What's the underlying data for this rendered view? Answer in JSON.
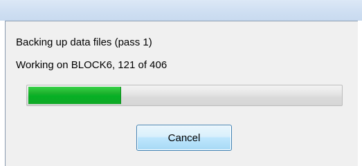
{
  "dialog": {
    "status_line_1": "Backing up data files (pass 1)",
    "status_line_2": "Working on BLOCK6, 121 of 406",
    "progress": {
      "current": 121,
      "total": 406,
      "fraction": 0.298,
      "fill_color": "#06b025"
    },
    "cancel_label": "Cancel"
  }
}
